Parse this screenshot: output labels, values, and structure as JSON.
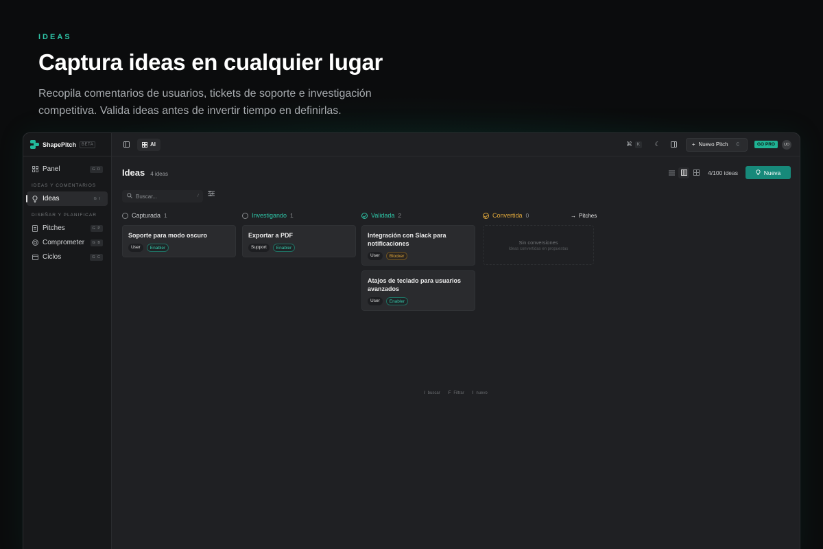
{
  "hero": {
    "eyebrow": "IDEAS",
    "title": "Captura ideas en cualquier lugar",
    "description": "Recopila comentarios de usuarios, tickets de soporte e investigación competitiva. Valida ideas antes de invertir tiempo en definirlas."
  },
  "app": {
    "brand": {
      "name": "ShapePitch",
      "badge": "BETA"
    },
    "sidebar": {
      "top_items": [
        {
          "label": "Panel",
          "shortcut": "G D",
          "icon": "grid-icon"
        }
      ],
      "section_ideas": "IDEAS Y COMENTARIOS",
      "ideas_items": [
        {
          "label": "Ideas",
          "shortcut": "G I",
          "icon": "bulb-icon",
          "active": true
        }
      ],
      "section_plan": "DISEÑAR Y PLANIFICAR",
      "plan_items": [
        {
          "label": "Pitches",
          "shortcut": "G P",
          "icon": "document-icon"
        },
        {
          "label": "Comprometer",
          "shortcut": "G B",
          "icon": "target-icon"
        },
        {
          "label": "Ciclos",
          "shortcut": "G C",
          "icon": "calendar-icon"
        }
      ]
    },
    "topbar": {
      "ai_label": "AI",
      "cmd_key": "K",
      "new_pitch_label": "Nuevo Pitch",
      "new_pitch_key": "C",
      "gopro_label": "GO PRO",
      "avatar_initials": "UD"
    },
    "page": {
      "title": "Ideas",
      "count": "4 ideas",
      "quota": "4/100 ideas",
      "new_button": "Nueva",
      "search_placeholder": "Buscar...",
      "search_key": "/"
    },
    "columns": [
      {
        "name": "Capturada",
        "count": "1",
        "color": "#c9cbcd",
        "cards": [
          {
            "title": "Soporte para modo oscuro",
            "tags": [
              {
                "label": "User",
                "kind": "user"
              },
              {
                "label": "Enabler",
                "kind": "enabler"
              }
            ]
          }
        ]
      },
      {
        "name": "Investigando",
        "count": "1",
        "color": "#2ec4a6",
        "cards": [
          {
            "title": "Exportar a PDF",
            "tags": [
              {
                "label": "Support",
                "kind": "support"
              },
              {
                "label": "Enabler",
                "kind": "enabler"
              }
            ]
          }
        ]
      },
      {
        "name": "Validada",
        "count": "2",
        "color": "#2ec4a6",
        "cards": [
          {
            "title": "Integración con Slack para notificaciones",
            "tags": [
              {
                "label": "User",
                "kind": "user"
              },
              {
                "label": "Blocker",
                "kind": "blocker"
              }
            ]
          },
          {
            "title": "Atajos de teclado para usuarios avanzados",
            "tags": [
              {
                "label": "User",
                "kind": "user"
              },
              {
                "label": "Enabler",
                "kind": "enabler"
              }
            ]
          }
        ]
      },
      {
        "name": "Convertida",
        "count": "0",
        "color": "#e2a93b",
        "empty": {
          "title": "Sin conversiones",
          "subtitle": "Ideas convertidas en propuestas"
        }
      }
    ],
    "pitches_link": "Pitches",
    "hints": [
      {
        "key": "/",
        "label": "buscar"
      },
      {
        "key": "F",
        "label": "Filtrar"
      },
      {
        "key": "I",
        "label": "nuevo"
      }
    ]
  }
}
